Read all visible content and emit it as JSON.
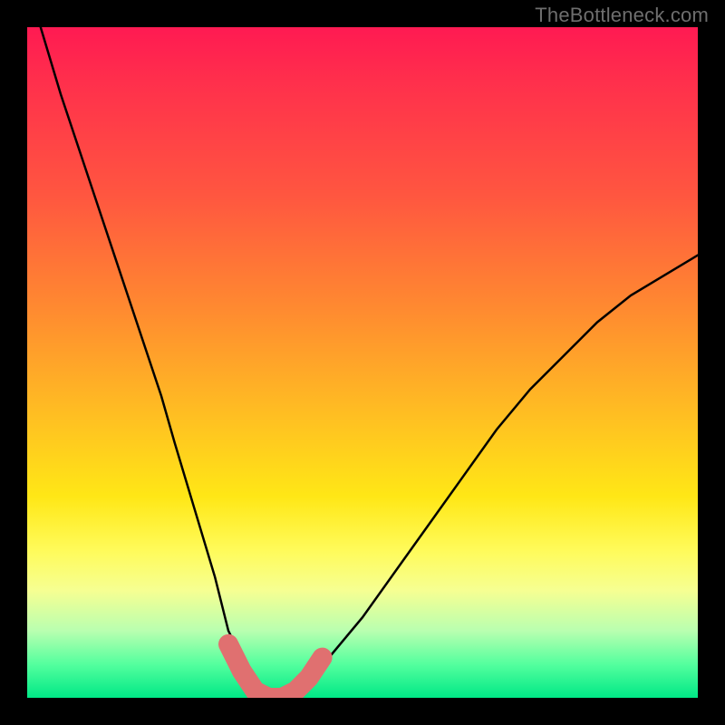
{
  "watermark": "TheBottleneck.com",
  "chart_data": {
    "type": "line",
    "title": "",
    "xlabel": "",
    "ylabel": "",
    "xlim": [
      0,
      100
    ],
    "ylim": [
      0,
      100
    ],
    "series": [
      {
        "name": "bottleneck-curve",
        "x": [
          2,
          5,
          10,
          15,
          20,
          22,
          25,
          28,
          30,
          32,
          33,
          35,
          37,
          38,
          40,
          42,
          45,
          50,
          55,
          60,
          65,
          70,
          75,
          80,
          85,
          90,
          95,
          100
        ],
        "values": [
          100,
          90,
          75,
          60,
          45,
          38,
          28,
          18,
          10,
          6,
          3,
          1,
          0,
          0,
          1,
          3,
          6,
          12,
          19,
          26,
          33,
          40,
          46,
          51,
          56,
          60,
          63,
          66
        ]
      }
    ],
    "markers": {
      "name": "highlight-region",
      "x": [
        30,
        32,
        34,
        36,
        38,
        40,
        42,
        44
      ],
      "values": [
        8,
        4,
        1,
        0,
        0,
        1,
        3,
        6
      ],
      "color": "#e07070"
    },
    "gradient_stops": [
      {
        "pos": 0.0,
        "color": "#ff1a52"
      },
      {
        "pos": 0.25,
        "color": "#ff5640"
      },
      {
        "pos": 0.5,
        "color": "#ffbf22"
      },
      {
        "pos": 0.78,
        "color": "#fffb5a"
      },
      {
        "pos": 0.9,
        "color": "#b9ffb0"
      },
      {
        "pos": 1.0,
        "color": "#00e886"
      }
    ]
  }
}
